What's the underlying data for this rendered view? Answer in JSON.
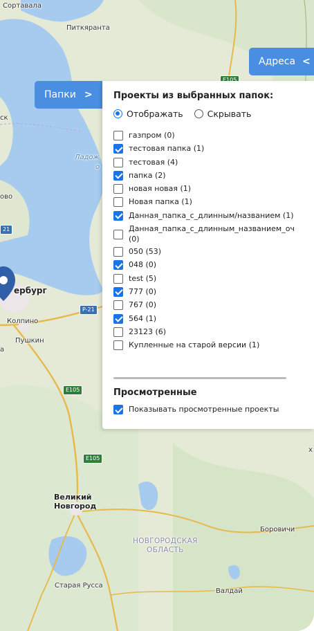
{
  "map": {
    "labels": {
      "sortavala": "Сортавала",
      "pitkyaranta": "Питкяранта",
      "ladoga": "Ладож",
      "ladoga2": "о",
      "spb": "ербург",
      "kolpino": "Колпино",
      "pushkin": "Пушкин",
      "veliky_novgorod": "Великий\nНовгород",
      "novgorod_region": "НОВГОРОДСКАЯ\nОБЛАСТЬ",
      "borovichi": "Боровичи",
      "staraya_russa": "Старая Русса",
      "valday": "Валдай",
      "sk": "ск",
      "ovo": "ово",
      "a": "а",
      "x": "х"
    },
    "roads": {
      "e105_top": "E105",
      "r21_left": "21",
      "r21": "P-21",
      "e105_mid": "E105",
      "e105_low": "E105"
    }
  },
  "addresses_button": {
    "label": "Адреса",
    "chevron": "<"
  },
  "folders_button": {
    "label": "Папки",
    "chevron": ">"
  },
  "panel": {
    "title": "Проекты из выбранных папок:",
    "radio": {
      "show": "Отображать",
      "hide": "Скрывать",
      "selected": "show"
    },
    "folders": [
      {
        "label": "газпром (0)",
        "checked": false
      },
      {
        "label": "тестовая папка (1)",
        "checked": true
      },
      {
        "label": "тестовая (4)",
        "checked": false
      },
      {
        "label": "папка (2)",
        "checked": true
      },
      {
        "label": "новая новая (1)",
        "checked": false
      },
      {
        "label": "Новая папка (1)",
        "checked": false
      },
      {
        "label": "Данная_папка_с_длинным/названием (1)",
        "checked": true
      },
      {
        "label": "Данная_папка_с_длинным_названием_оч\n(0)",
        "checked": false
      },
      {
        "label": "050 (53)",
        "checked": false
      },
      {
        "label": "048 (0)",
        "checked": true
      },
      {
        "label": "test (5)",
        "checked": false
      },
      {
        "label": "777 (0)",
        "checked": true
      },
      {
        "label": "767 (0)",
        "checked": false
      },
      {
        "label": "564 (1)",
        "checked": true
      },
      {
        "label": "23123 (6)",
        "checked": false
      },
      {
        "label": "Купленные на старой версии (1)",
        "checked": false
      }
    ],
    "viewed": {
      "title": "Просмотренные",
      "show_viewed_label": "Показывать просмотренные проекты",
      "show_viewed_checked": true
    }
  },
  "colors": {
    "accent": "#4a8ee2",
    "checkbox": "#1a73e8",
    "water": "#a6cbee",
    "land": "#e6ecd9"
  }
}
